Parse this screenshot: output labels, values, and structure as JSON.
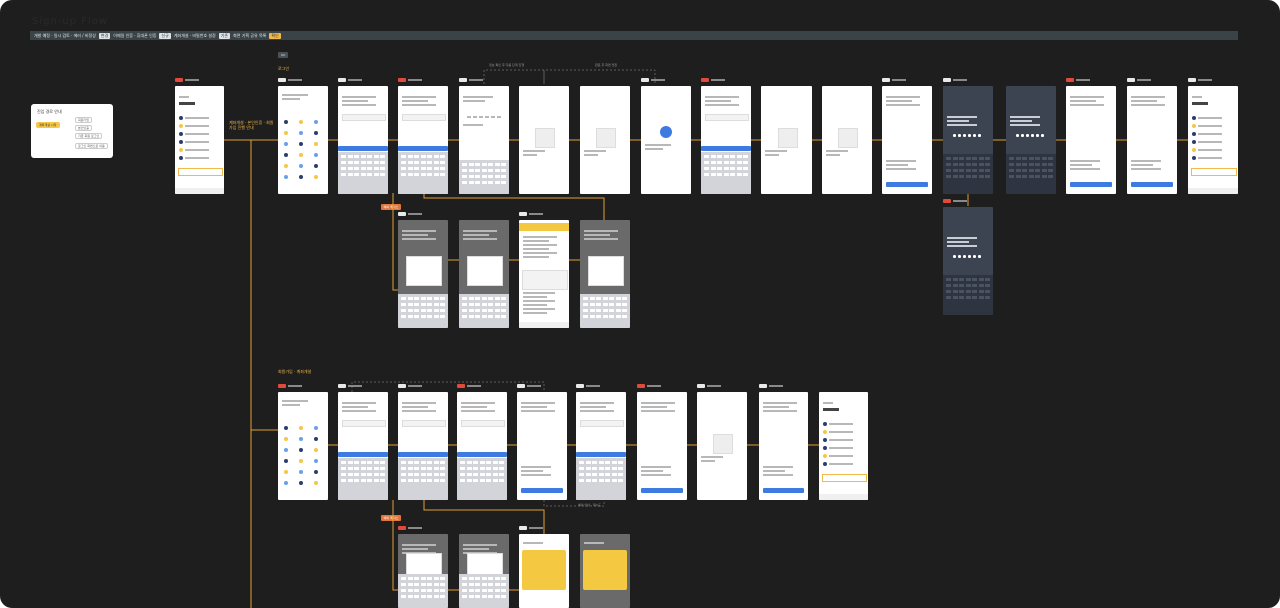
{
  "page": {
    "title": "Sign-up Flow",
    "ok_chip": "OK",
    "section_labels": [
      "로그인",
      "회원가입 · 계좌개설"
    ],
    "orange_tags": [
      "예외 케이스",
      "예외 케이스"
    ]
  },
  "banner": [
    {
      "text": "개발 예정 · 일시 검토 · 에러 / 비정상",
      "chip": false
    },
    {
      "text": "변경",
      "chip": true
    },
    {
      "text": "이메일 인증 · 휴대폰 인증",
      "chip": false
    },
    {
      "text": "신규",
      "chip": true
    },
    {
      "text": "계좌개설 · 비밀번호 설정",
      "chip": false
    },
    {
      "text": "기존",
      "chip": true
    },
    {
      "text": "화면 기획 공유 목록",
      "chip": false
    },
    {
      "text": "확인",
      "chip": true,
      "accent": true
    }
  ],
  "note_card": {
    "heading": "진입 경로 안내",
    "items": [
      "계좌개설 시작",
      "회원가입",
      "본인인증",
      "기존 회원 로그인",
      "로그인 화면으로 이동"
    ]
  },
  "side_note": "계좌개설 · 본인인증 · 회원가입 진행 안내",
  "colors": {
    "canvas": "#1e1e1e",
    "accent_yellow": "#f6c744",
    "flow_line": "#e0a030",
    "primary_blue": "#3d7be0",
    "status_red": "#e04a3a",
    "exception_orange": "#e0763a"
  }
}
